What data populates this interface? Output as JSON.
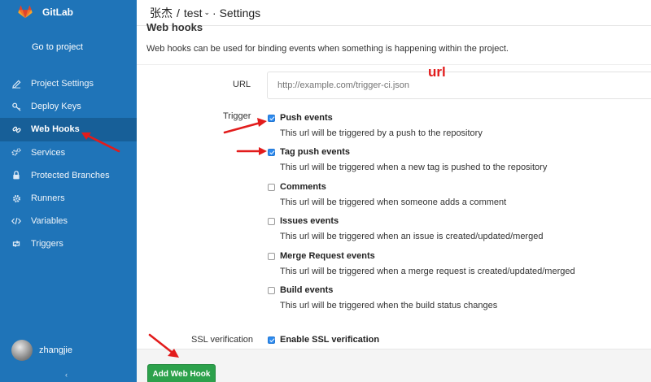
{
  "app": {
    "name": "GitLab"
  },
  "sidebar": {
    "goto": "Go to project",
    "items": [
      {
        "label": "Project Settings",
        "icon": "edit-icon"
      },
      {
        "label": "Deploy Keys",
        "icon": "key-icon"
      },
      {
        "label": "Web Hooks",
        "icon": "link-icon",
        "active": true
      },
      {
        "label": "Services",
        "icon": "cogs-icon"
      },
      {
        "label": "Protected Branches",
        "icon": "lock-icon"
      },
      {
        "label": "Runners",
        "icon": "gear-icon"
      },
      {
        "label": "Variables",
        "icon": "code-icon"
      },
      {
        "label": "Triggers",
        "icon": "retweet-icon"
      }
    ],
    "user": "zhangjie",
    "collapse": "‹"
  },
  "header": {
    "owner": "张杰",
    "sep": "/",
    "project": "test",
    "chevron": "⌄",
    "page": "· Settings"
  },
  "main": {
    "title": "Web hooks",
    "intro": "Web hooks can be used for binding events when something is happening within the project.",
    "url_label": "URL",
    "url_value": "http://example.com/trigger-ci.json",
    "trigger_label": "Trigger",
    "triggers": [
      {
        "name": "Push events",
        "desc": "This url will be triggered by a push to the repository",
        "checked": true
      },
      {
        "name": "Tag push events",
        "desc": "This url will be triggered when a new tag is pushed to the repository",
        "checked": true
      },
      {
        "name": "Comments",
        "desc": "This url will be triggered when someone adds a comment",
        "checked": false
      },
      {
        "name": "Issues events",
        "desc": "This url will be triggered when an issue is created/updated/merged",
        "checked": false
      },
      {
        "name": "Merge Request events",
        "desc": "This url will be triggered when a merge request is created/updated/merged",
        "checked": false
      },
      {
        "name": "Build events",
        "desc": "This url will be triggered when the build status changes",
        "checked": false
      }
    ],
    "ssl_label": "SSL verification",
    "ssl_option": "Enable SSL verification",
    "ssl_checked": true,
    "add_button": "Add Web Hook"
  },
  "annotation": {
    "url": "url",
    "color": "#e21c1c"
  },
  "colors": {
    "sidebar": "#1f74b8",
    "sidebar_active": "#175f98",
    "button": "#2ca14b",
    "checkbox": "#2d8bf0"
  }
}
